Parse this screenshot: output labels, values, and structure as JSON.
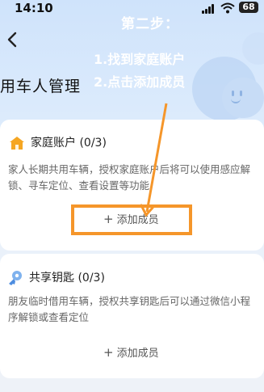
{
  "status_bar": {
    "time": "14:10",
    "battery": "68",
    "signal_icon": "signal-icon",
    "wifi_icon": "wifi-icon"
  },
  "nav": {
    "back_icon": "chevron-left-icon",
    "page_title": "用车人管理"
  },
  "annotation": {
    "step": "第二步：",
    "line1": "1.找到家庭账户",
    "line2": "2.点击添加成员",
    "color": "#f5962a"
  },
  "family_account": {
    "icon": "home-icon",
    "title": "家庭账户 (0/3)",
    "description": "家人长期共用车辆，授权家庭账户后将可以使用感应解锁、寻车定位、查看设置等功能",
    "add_button": "添加成员"
  },
  "shared_key": {
    "icon": "key-icon",
    "title": "共享钥匙 (0/3)",
    "description": "朋友临时借用车辆，授权共享钥匙后可以通过微信小程序解锁或查看定位",
    "add_button": "添加成员"
  }
}
